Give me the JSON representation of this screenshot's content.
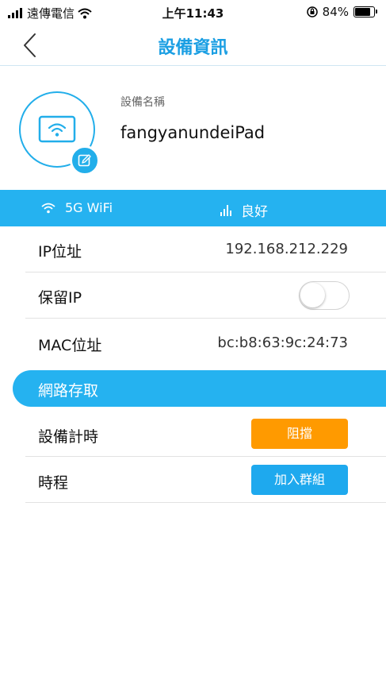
{
  "status_bar": {
    "carrier": "遠傳電信",
    "time": "上午11:43",
    "battery": "84%",
    "battery_level": 0.84
  },
  "nav": {
    "title": "設備資訊",
    "back_icon": "chevron-left-icon"
  },
  "device": {
    "name_label": "設備名稱",
    "name": "fangyanundeiPad",
    "icon": "tablet-wifi-icon",
    "edit_icon": "edit-icon"
  },
  "connection": {
    "band": "5G WiFi",
    "quality": "良好"
  },
  "info_rows": {
    "ip_label": "IP位址",
    "ip_value": "192.168.212.229",
    "reserve_ip_label": "保留IP",
    "reserve_ip_on": false,
    "mac_label": "MAC位址",
    "mac_value": "bc:b8:63:9c:24:73"
  },
  "access": {
    "section_title": "網路存取",
    "timer_label": "設備計時",
    "block_button": "阻擋",
    "schedule_label": "時程",
    "join_group_button": "加入群組"
  },
  "colors": {
    "accent": "#25b2f0",
    "title": "#1b9fe3",
    "block": "#ff9a00"
  }
}
